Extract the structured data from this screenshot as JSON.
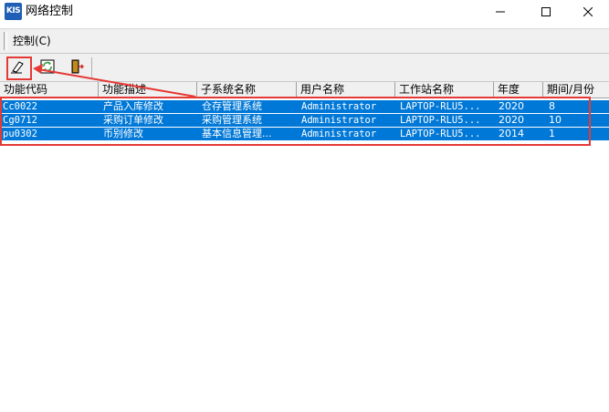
{
  "window": {
    "app_icon": "KIS",
    "title": "网络控制",
    "controls": [
      "minimize-icon",
      "maximize-icon",
      "close-icon"
    ]
  },
  "menu": {
    "items": [
      {
        "label": "控制(C)"
      }
    ]
  },
  "toolbar": {
    "buttons": [
      {
        "icon": "eraser-icon"
      },
      {
        "icon": "refresh-icon"
      },
      {
        "icon": "exit-door-icon"
      }
    ]
  },
  "table": {
    "columns": [
      "功能代码",
      "功能描述",
      "子系统名称",
      "用户名称",
      "工作站名称",
      "年度",
      "期间/月份"
    ],
    "rows": [
      {
        "code": "Cc0022",
        "desc": "产品入库修改",
        "subsystem": "仓存管理系统",
        "user": "Administrator",
        "workstation": "LAPTOP-RLU5...",
        "year": "2020",
        "period": "8"
      },
      {
        "code": "Cg0712",
        "desc": "采购订单修改",
        "subsystem": "采购管理系统",
        "user": "Administrator",
        "workstation": "LAPTOP-RLU5...",
        "year": "2020",
        "period": "10"
      },
      {
        "code": "pu0302",
        "desc": "币别修改",
        "subsystem": "基本信息管理...",
        "user": "Administrator",
        "workstation": "LAPTOP-RLU5...",
        "year": "2014",
        "period": "1"
      }
    ],
    "selection_color": "#0078d7"
  },
  "annotation": {
    "color": "#e53935"
  }
}
